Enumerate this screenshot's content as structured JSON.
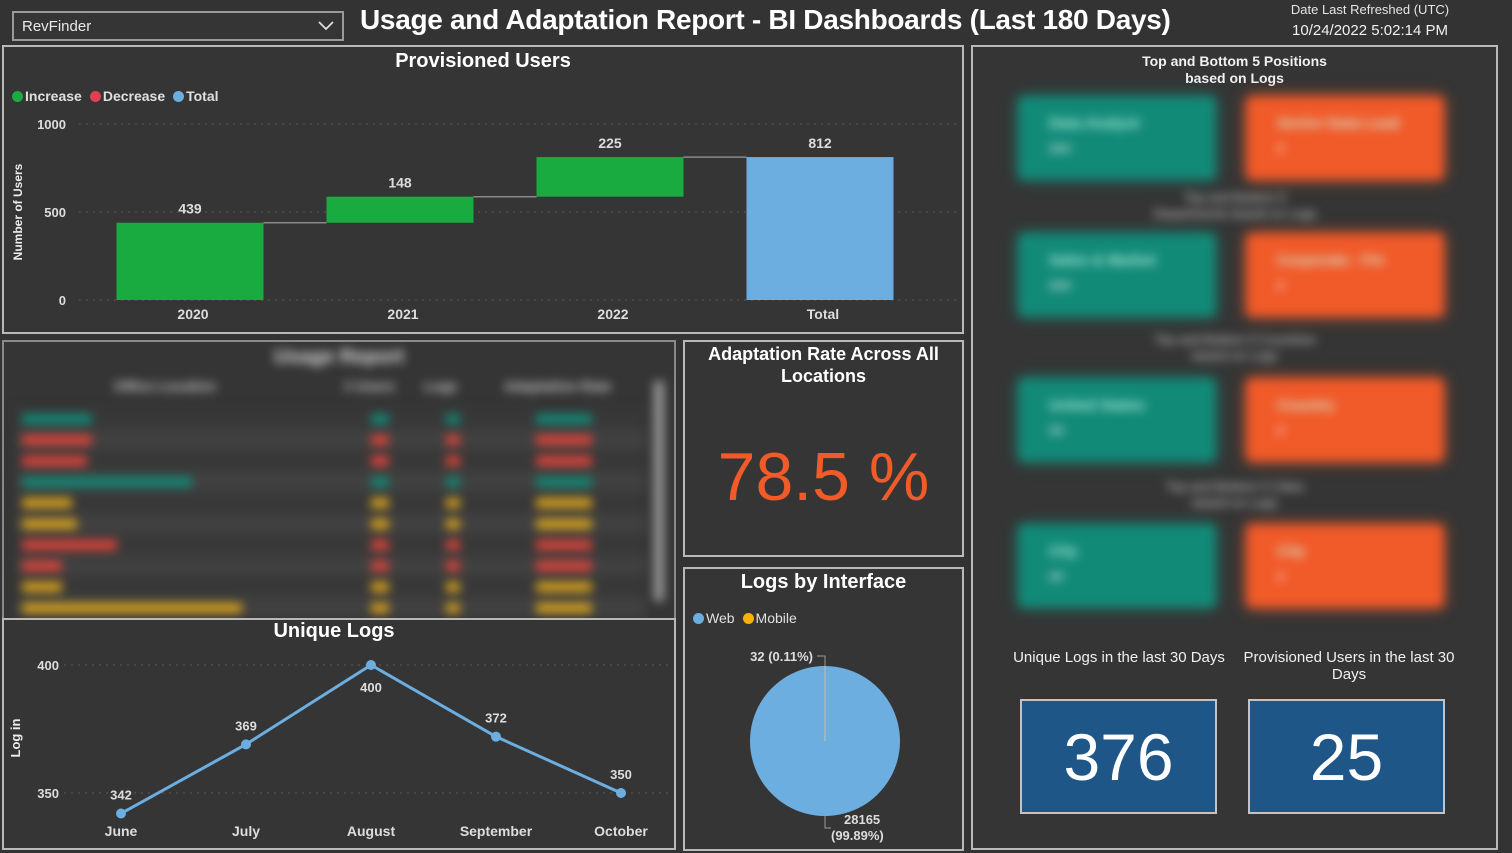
{
  "header": {
    "slicer_value": "RevFinder",
    "title": "Usage and Adaptation Report - BI Dashboards (Last 180 Days)",
    "refresh_label": "Date Last Refreshed (UTC)",
    "refresh_value": "10/24/2022 5:02:14 PM"
  },
  "colors": {
    "increase": "#1aab40",
    "decrease": "#e0404f",
    "total": "#6daee0",
    "web": "#6daee0",
    "mobile": "#f5b300",
    "adaptation": "#f15a29",
    "kpi_box": "#1f5688",
    "good_tile": "#128a78",
    "bad_tile": "#f15a29"
  },
  "provisioned_users": {
    "title": "Provisioned Users",
    "legend": [
      "Increase",
      "Decrease",
      "Total"
    ]
  },
  "usage_report": {
    "title": "Usage Report",
    "columns": [
      "Office Location",
      "# Users",
      "Logs",
      "Adaptation Rate"
    ],
    "note": "content blurred/unreadable in screenshot"
  },
  "adaptation": {
    "title": "Adaptation Rate Across All Locations",
    "value": "78.5 %"
  },
  "unique_logs": {
    "title": "Unique Logs"
  },
  "logs_by_interface": {
    "title": "Logs by Interface",
    "legend": [
      "Web",
      "Mobile"
    ]
  },
  "top_bottom": {
    "title_line1": "Top and Bottom 5 Positions",
    "title_line2": "based on Logs",
    "note": "tiles blurred/unreadable in screenshot"
  },
  "kpis": {
    "unique_logs_label": "Unique Logs in the last 30 Days",
    "unique_logs_value": "376",
    "provisioned_label": "Provisioned Users in the last 30 Days",
    "provisioned_value": "25"
  },
  "chart_data": [
    {
      "type": "bar",
      "subtype": "waterfall",
      "title": "Provisioned Users",
      "categories": [
        "2020",
        "2021",
        "2022",
        "Total"
      ],
      "values": [
        439,
        148,
        225,
        812
      ],
      "kinds": [
        "increase",
        "increase",
        "increase",
        "total"
      ],
      "ylabel": "Number of Users",
      "xlabel": "",
      "ylim": [
        0,
        1000
      ],
      "yticks": [
        0,
        500,
        1000
      ],
      "legend": [
        "Increase",
        "Decrease",
        "Total"
      ],
      "legend_position": "top-left",
      "grid": true
    },
    {
      "type": "line",
      "title": "Unique Logs",
      "categories": [
        "June",
        "July",
        "August",
        "September",
        "October"
      ],
      "values": [
        342,
        369,
        400,
        372,
        350
      ],
      "ylabel": "Log in",
      "xlabel": "",
      "ylim": [
        336,
        400
      ],
      "yticks": [
        350,
        400
      ],
      "grid": true
    },
    {
      "type": "pie",
      "title": "Logs by Interface",
      "labels": [
        "Web",
        "Mobile"
      ],
      "values": [
        28165,
        32
      ],
      "percent_labels": [
        "28165 (99.89%)",
        "32 (0.11%)"
      ],
      "legend_position": "top-left"
    }
  ]
}
